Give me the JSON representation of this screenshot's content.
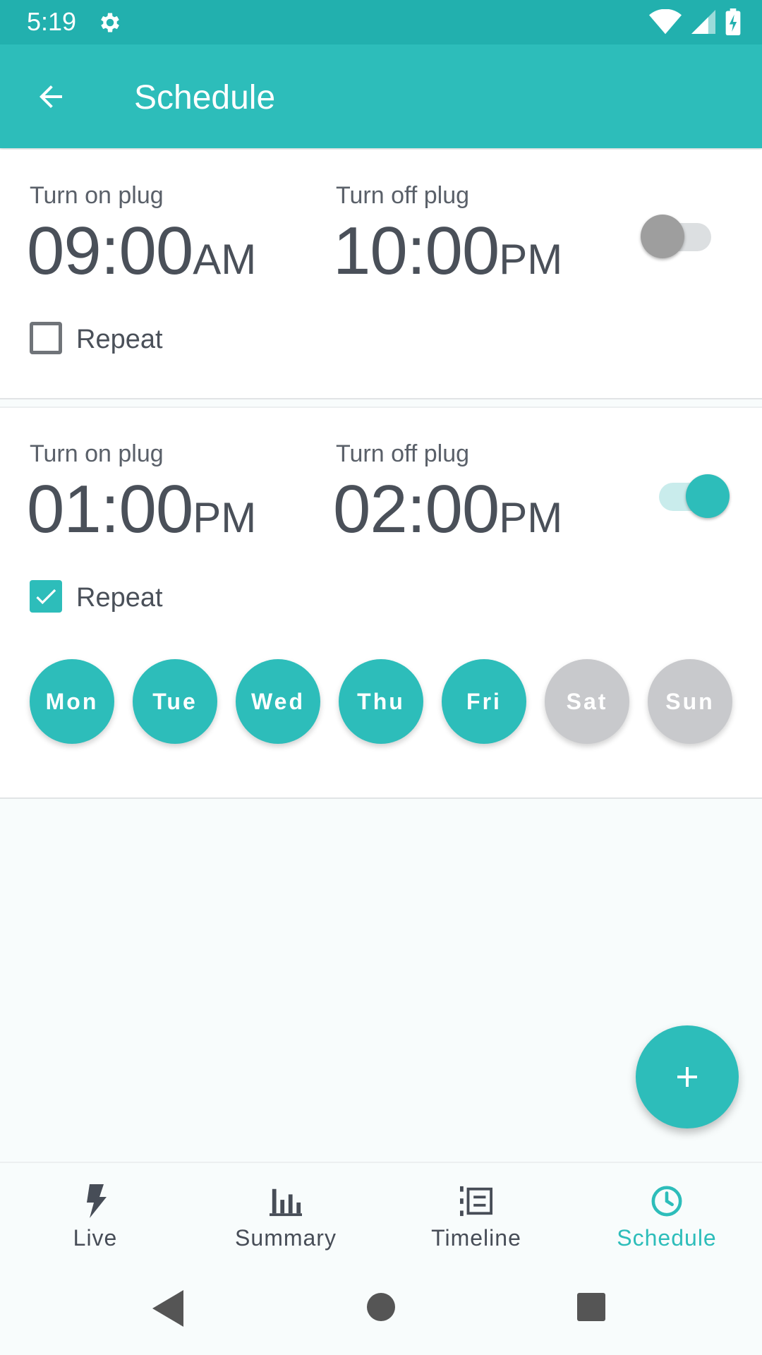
{
  "status_bar": {
    "time": "5:19"
  },
  "app_bar": {
    "title": "Schedule"
  },
  "schedules": [
    {
      "on_label": "Turn on plug",
      "on_time": "09:00",
      "on_ampm": "AM",
      "off_label": "Turn off plug",
      "off_time": "10:00",
      "off_ampm": "PM",
      "enabled": false,
      "repeat_label": "Repeat",
      "repeat_checked": false
    },
    {
      "on_label": "Turn on plug",
      "on_time": "01:00",
      "on_ampm": "PM",
      "off_label": "Turn off plug",
      "off_time": "02:00",
      "off_ampm": "PM",
      "enabled": true,
      "repeat_label": "Repeat",
      "repeat_checked": true,
      "days": [
        {
          "label": "Mon",
          "active": true
        },
        {
          "label": "Tue",
          "active": true
        },
        {
          "label": "Wed",
          "active": true
        },
        {
          "label": "Thu",
          "active": true
        },
        {
          "label": "Fri",
          "active": true
        },
        {
          "label": "Sat",
          "active": false
        },
        {
          "label": "Sun",
          "active": false
        }
      ]
    }
  ],
  "fab": {
    "icon": "plus-icon"
  },
  "bottom_nav": {
    "items": [
      {
        "label": "Live",
        "icon": "lightning-icon",
        "active": false
      },
      {
        "label": "Summary",
        "icon": "bar-chart-icon",
        "active": false
      },
      {
        "label": "Timeline",
        "icon": "timeline-list-icon",
        "active": false
      },
      {
        "label": "Schedule",
        "icon": "clock-icon",
        "active": true
      }
    ]
  },
  "colors": {
    "primary": "#2dbdba",
    "status_bar": "#22b0ae",
    "inactive_day": "#c8c9cc"
  }
}
